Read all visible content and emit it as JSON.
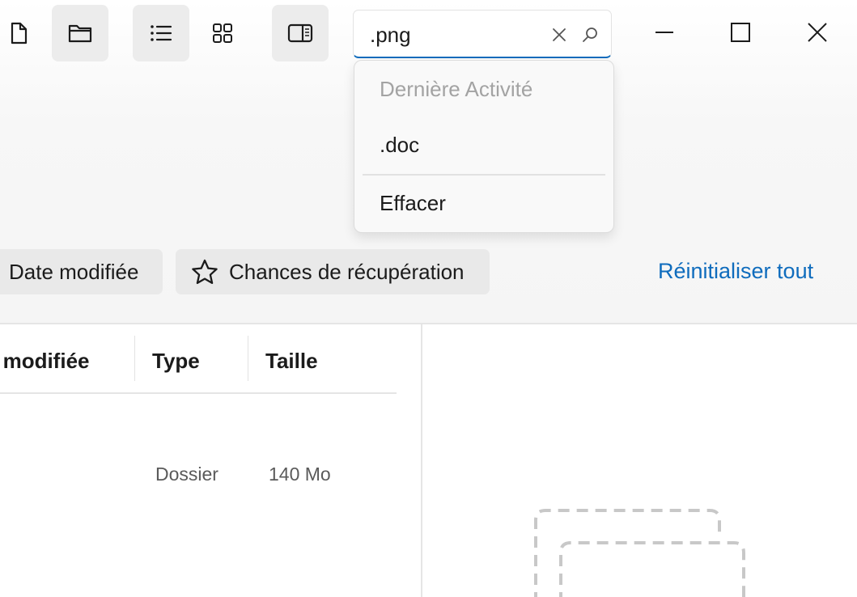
{
  "toolbar": {
    "buttons": [
      {
        "name": "new-file-icon",
        "active": false
      },
      {
        "name": "folder-icon",
        "active": true
      },
      {
        "name": "list-view-icon",
        "active": true
      },
      {
        "name": "grid-view-icon",
        "active": false
      },
      {
        "name": "preview-pane-icon",
        "active": true
      }
    ]
  },
  "search": {
    "value": ".png",
    "clear_icon": "close-icon",
    "search_icon": "search-icon"
  },
  "dropdown": {
    "heading": "Dernière Activité",
    "items": [
      {
        "label": ".doc"
      }
    ],
    "clear_label": "Effacer"
  },
  "window": {
    "controls": [
      "minimize-icon",
      "maximize-icon",
      "close-icon"
    ]
  },
  "filters": {
    "chips": [
      {
        "label": "Date modifiée"
      },
      {
        "label": "Chances de récupération",
        "icon": "star-icon"
      }
    ],
    "reset_label": "Réinitialiser tout"
  },
  "table": {
    "columns": [
      "Date modifiée",
      "Type",
      "Taille"
    ],
    "rows": [
      {
        "type": "Dossier",
        "size": "140 Mo"
      }
    ]
  },
  "colors": {
    "accent": "#0f6cbd",
    "chip_bg": "#e9e9e9",
    "active_button_bg": "#ececec"
  }
}
